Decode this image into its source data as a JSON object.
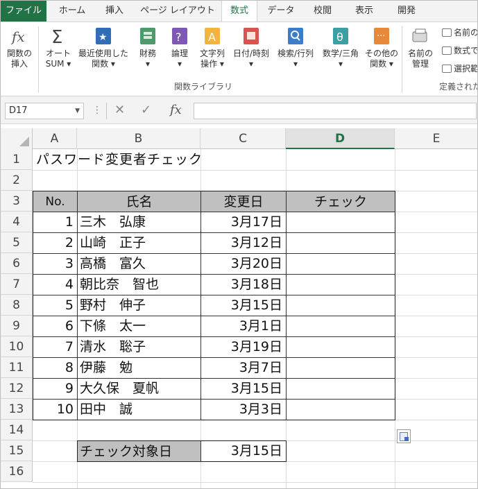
{
  "ribbon": {
    "tabs": [
      {
        "label": "ファイル",
        "kind": "file"
      },
      {
        "label": "ホーム"
      },
      {
        "label": "挿入"
      },
      {
        "label": "ページ レイアウト"
      },
      {
        "label": "数式",
        "kind": "active"
      },
      {
        "label": "データ"
      },
      {
        "label": "校閲"
      },
      {
        "label": "表示"
      },
      {
        "label": "開発"
      }
    ],
    "buttons": {
      "insert_function": {
        "line1": "関数の",
        "line2": "挿入"
      },
      "autosum": {
        "line1": "オート",
        "line2": "SUM ▾"
      },
      "recent": {
        "line1": "最近使用した",
        "line2": "関数 ▾"
      },
      "financial": {
        "line1": "財務",
        "line2": "▾"
      },
      "logical": {
        "line1": "論理",
        "line2": "▾"
      },
      "text": {
        "line1": "文字列",
        "line2": "操作 ▾"
      },
      "datetime": {
        "line1": "日付/時刻",
        "line2": "▾"
      },
      "lookup": {
        "line1": "検索/行列",
        "line2": "▾"
      },
      "math": {
        "line1": "数学/三角",
        "line2": "▾"
      },
      "more": {
        "line1": "その他の",
        "line2": "関数 ▾"
      },
      "name_manager": {
        "line1": "名前の",
        "line2": "管理"
      }
    },
    "small": {
      "define_name": "名前の",
      "use_in_formula": "数式で",
      "create_from_selection": "選択範"
    },
    "groups": {
      "function_library": "関数ライブラリ",
      "defined_names": "定義された"
    },
    "colors": {
      "accent": "#217346"
    }
  },
  "formula_bar": {
    "name_box": "D17",
    "fx": "fx",
    "cancel_icon": "✕",
    "enter_icon": "✓",
    "formula": ""
  },
  "grid": {
    "columns": [
      "A",
      "B",
      "C",
      "D",
      "E"
    ],
    "rows": [
      "1",
      "2",
      "3",
      "4",
      "5",
      "6",
      "7",
      "8",
      "9",
      "10",
      "11",
      "12",
      "13",
      "14",
      "15",
      "16"
    ],
    "title": "パスワード変更者チェック",
    "headers": {
      "no": "No.",
      "name": "氏名",
      "date": "変更日",
      "check": "チェック"
    },
    "records": [
      {
        "no": "1",
        "name": "三木　弘康",
        "date": "3月17日"
      },
      {
        "no": "2",
        "name": "山崎　正子",
        "date": "3月12日"
      },
      {
        "no": "3",
        "name": "高橋　富久",
        "date": "3月20日"
      },
      {
        "no": "4",
        "name": "朝比奈　智也",
        "date": "3月18日"
      },
      {
        "no": "5",
        "name": "野村　伸子",
        "date": "3月15日"
      },
      {
        "no": "6",
        "name": "下條　太一",
        "date": "3月1日"
      },
      {
        "no": "7",
        "name": "清水　聡子",
        "date": "3月19日"
      },
      {
        "no": "8",
        "name": "伊藤　勉",
        "date": "3月7日"
      },
      {
        "no": "9",
        "name": "大久保　夏帆",
        "date": "3月15日"
      },
      {
        "no": "10",
        "name": "田中　誠",
        "date": "3月3日"
      }
    ],
    "target": {
      "label": "チェック対象日",
      "date": "3月15日"
    }
  }
}
